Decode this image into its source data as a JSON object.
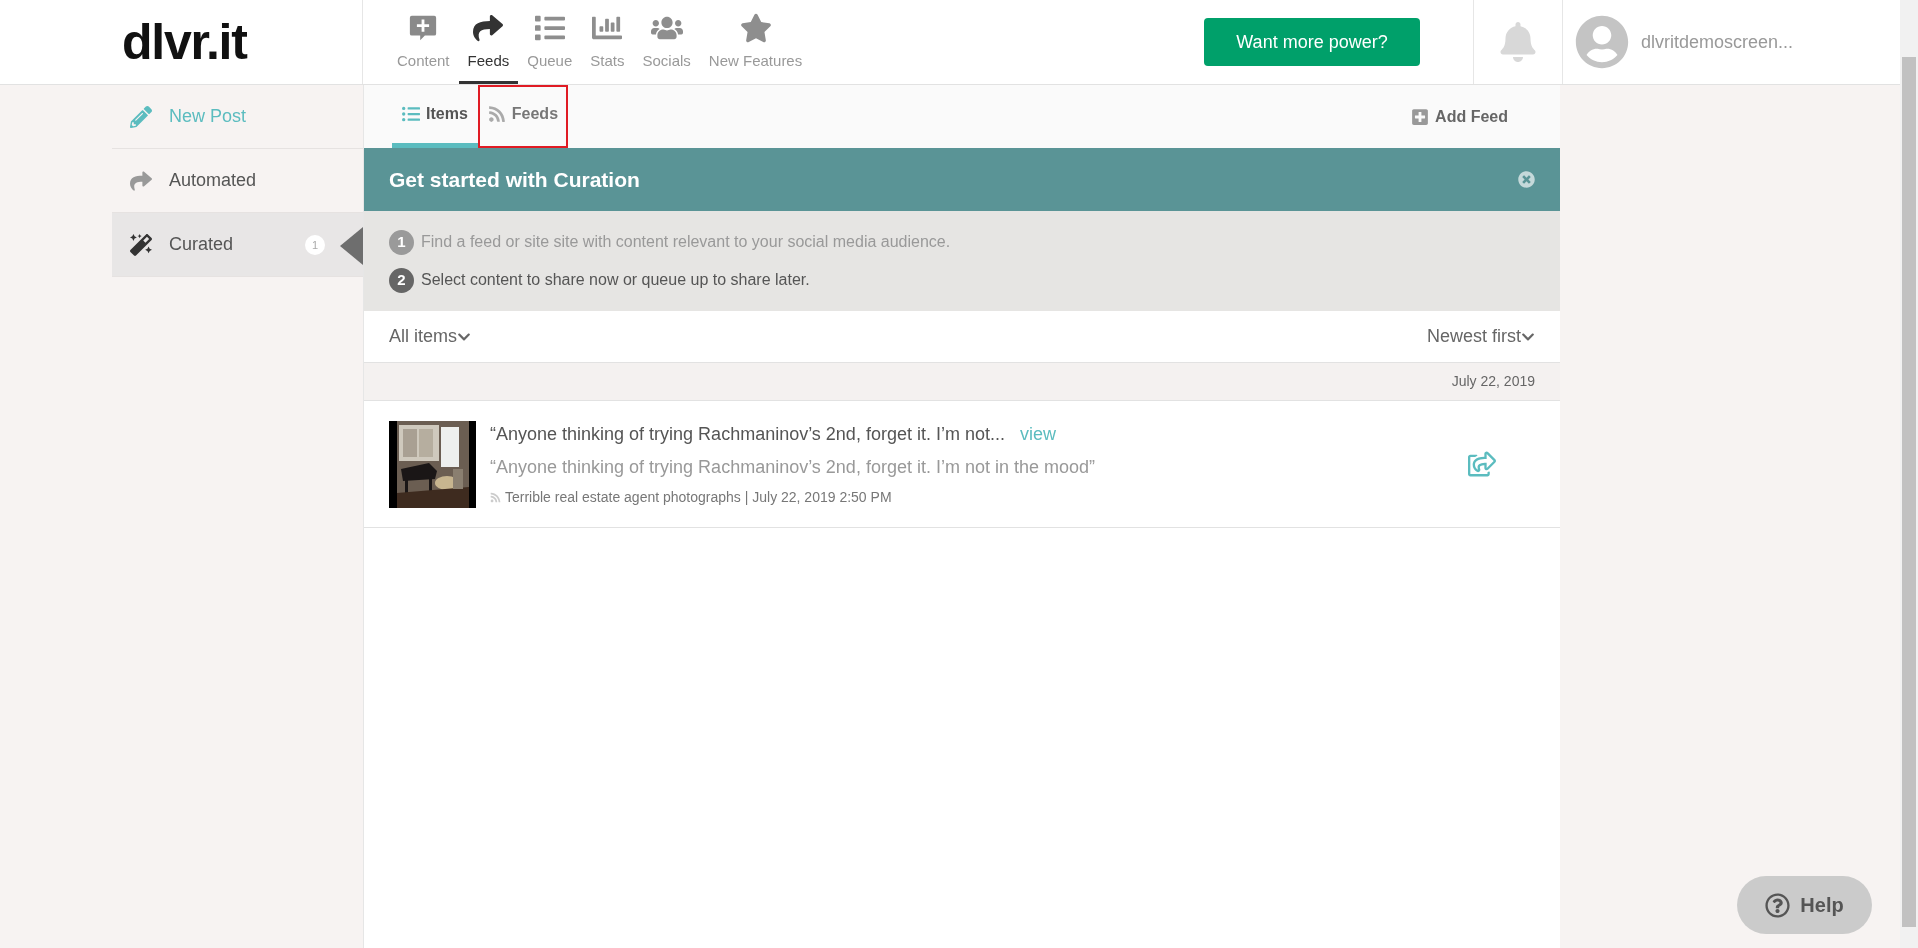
{
  "logo": "dlvr.it",
  "nav": [
    {
      "label": "Content",
      "selected": false
    },
    {
      "label": "Feeds",
      "selected": true
    },
    {
      "label": "Queue",
      "selected": false
    },
    {
      "label": "Stats",
      "selected": false
    },
    {
      "label": "Socials",
      "selected": false
    },
    {
      "label": "New Features",
      "selected": false
    }
  ],
  "upgrade_button": "Want more power?",
  "user": {
    "name": "dlvritdemoscreen..."
  },
  "sidebar": {
    "items": [
      {
        "label": "New Post",
        "kind": "action",
        "selected": false
      },
      {
        "label": "Automated",
        "kind": "link",
        "selected": false
      },
      {
        "label": "Curated",
        "kind": "link",
        "selected": true,
        "badge": "1"
      }
    ]
  },
  "tabs": [
    {
      "label": "Items",
      "selected": true,
      "highlighted": false
    },
    {
      "label": "Feeds",
      "selected": false,
      "highlighted": true
    }
  ],
  "add_feed": "Add Feed",
  "banner": {
    "title": "Get started with Curation",
    "steps": [
      {
        "number": "1",
        "text": "Find a feed or site site with content relevant to your social media audience.",
        "done": true
      },
      {
        "number": "2",
        "text": "Select content to share now or queue up to share later.",
        "done": false
      }
    ]
  },
  "filter": "All items",
  "sort": "Newest first",
  "date_header": "July 22, 2019",
  "items": [
    {
      "title": "“Anyone thinking of trying Rachmaninov’s 2nd, forget it. I’m not...",
      "link": "view",
      "summary": "“Anyone thinking of trying Rachmaninov’s 2nd, forget it. I’m not in the mood”",
      "source": "Terrible real estate agent photographs | July 22, 2019 2:50 PM"
    }
  ],
  "help": "Help"
}
